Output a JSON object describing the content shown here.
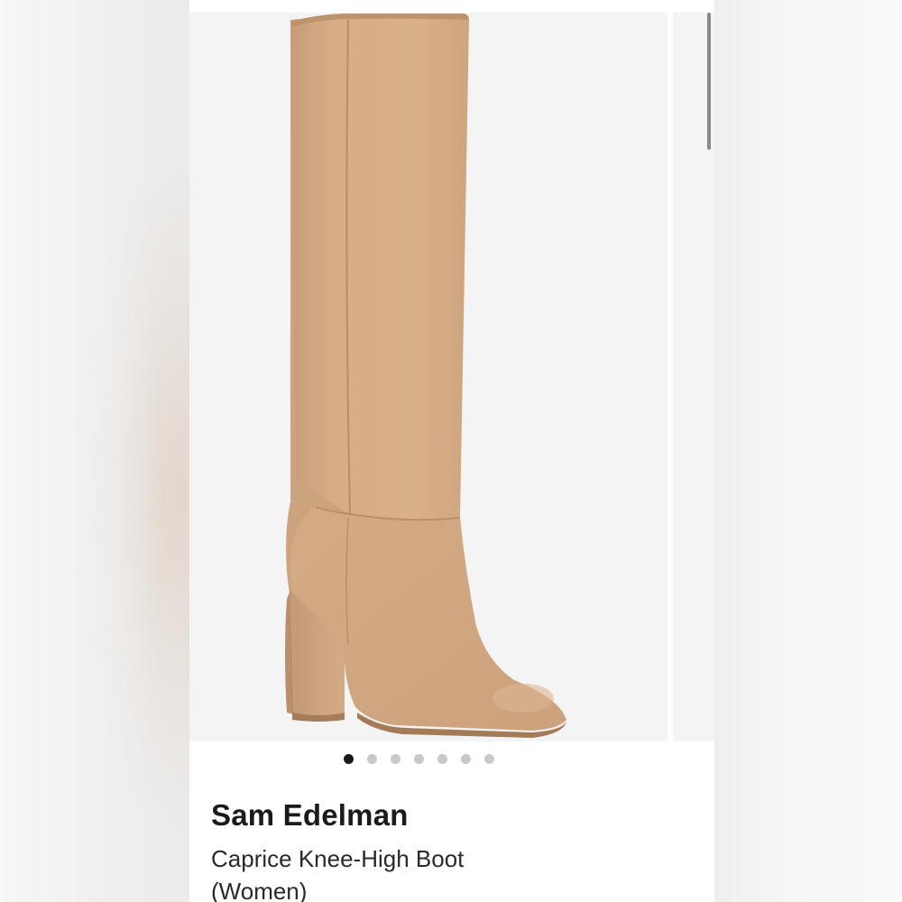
{
  "product": {
    "brand": "Sam Edelman",
    "name": "Caprice Knee-High Boot (Women)",
    "image_icon": "boot-photo",
    "boot_color": "#d2a982"
  },
  "carousel": {
    "dot_count": 7,
    "active_index": 0
  },
  "colors": {
    "dot_active": "#1a1a1a",
    "dot_inactive": "#c8c8c8",
    "image_bg": "#f4f4f4"
  }
}
